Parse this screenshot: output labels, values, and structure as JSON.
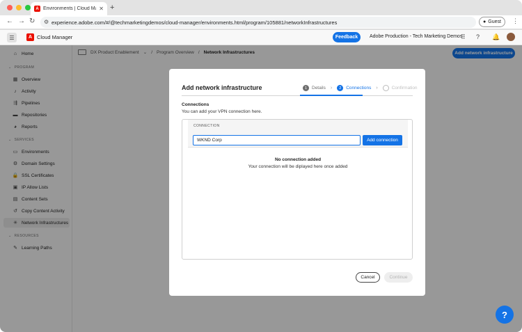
{
  "browser": {
    "tab_title": "Environments | Cloud Manager",
    "new_tab": "+",
    "url": "experience.adobe.com/#/@techmarketingdemos/cloud-manager/environments.html/program/105881/networkInfrastructures",
    "guest_label": "Guest",
    "dot_colors": [
      "#fe5f57",
      "#febc2e",
      "#28c840"
    ]
  },
  "header": {
    "app_name": "Cloud Manager",
    "feedback_label": "Feedback",
    "org_name": "Adobe Production - Tech Marketing Demos"
  },
  "sidebar": {
    "home": "Home",
    "program_section": "PROGRAM",
    "program_items": [
      "Overview",
      "Activity",
      "Pipelines",
      "Repositories",
      "Reports"
    ],
    "services_section": "SERVICES",
    "services_items": [
      "Environments",
      "Domain Settings",
      "SSL Certificates",
      "IP Allow Lists",
      "Content Sets",
      "Copy Content Activity",
      "Network Infrastructures"
    ],
    "resources_section": "RESOURCES",
    "resources_items": [
      "Learning Paths"
    ]
  },
  "breadcrumb": {
    "program": "DX Product Enablement",
    "overview": "Program Overview",
    "current": "Network Infrastructures"
  },
  "main": {
    "add_network_label": "Add network infrastructure"
  },
  "modal": {
    "title": "Add network infrastructure",
    "steps": [
      {
        "num": "1",
        "label": "Details"
      },
      {
        "num": "2",
        "label": "Connections"
      },
      {
        "num": "",
        "label": "Confirmation"
      }
    ],
    "section_title": "Connections",
    "section_desc": "You can add your VPN connection here.",
    "column_header": "CONNECTION",
    "input_value": "WKND Corp",
    "add_connection_label": "Add connection",
    "empty_title": "No connection added",
    "empty_desc": "Your connection will be diplayed here once added",
    "cancel_label": "Cancel",
    "continue_label": "Continue"
  },
  "help_label": "?"
}
